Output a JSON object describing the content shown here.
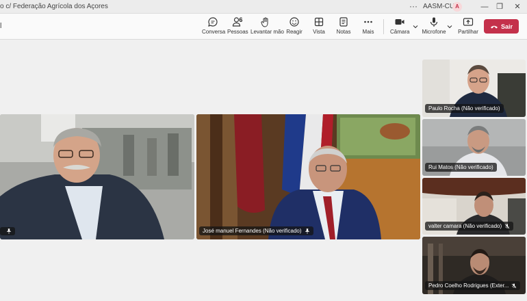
{
  "titlebar": {
    "title": "o c/ Federação Agrícola dos Açores",
    "account": "AASM-CUA",
    "avatar_initial": "A",
    "more_label": "···"
  },
  "toolbar": {
    "left_fragment": "l",
    "buttons": [
      {
        "label": "Conversa",
        "icon": "chat-icon"
      },
      {
        "label": "Pessoas",
        "icon": "people-icon",
        "count": "6"
      },
      {
        "label": "Levantar mão",
        "icon": "hand-icon"
      },
      {
        "label": "Reagir",
        "icon": "smile-icon"
      },
      {
        "label": "Vista",
        "icon": "grid-icon"
      },
      {
        "label": "Notas",
        "icon": "notes-icon"
      },
      {
        "label": "Mais",
        "icon": "more-icon"
      },
      {
        "label": "Câmara",
        "icon": "camera-icon"
      },
      {
        "label": "Microfone",
        "icon": "mic-icon"
      },
      {
        "label": "Partilhar",
        "icon": "share-icon"
      }
    ],
    "leave_label": "Sair"
  },
  "participants": [
    {
      "name": "",
      "pinned": true
    },
    {
      "name": "José manuel Fernandes (Não verificado)",
      "pinned": true
    },
    {
      "name": "Paulo Rocha (Não verificado)",
      "muted": false
    },
    {
      "name": "Rui Matos (Não verificado)",
      "muted": false
    },
    {
      "name": "valter camara (Não verificado)",
      "muted": true
    },
    {
      "name": "Pedro Coelho Rodrigues (Exter...",
      "muted": true
    }
  ],
  "colors": {
    "accent": "#5b5fc7",
    "leave": "#c4314b"
  }
}
